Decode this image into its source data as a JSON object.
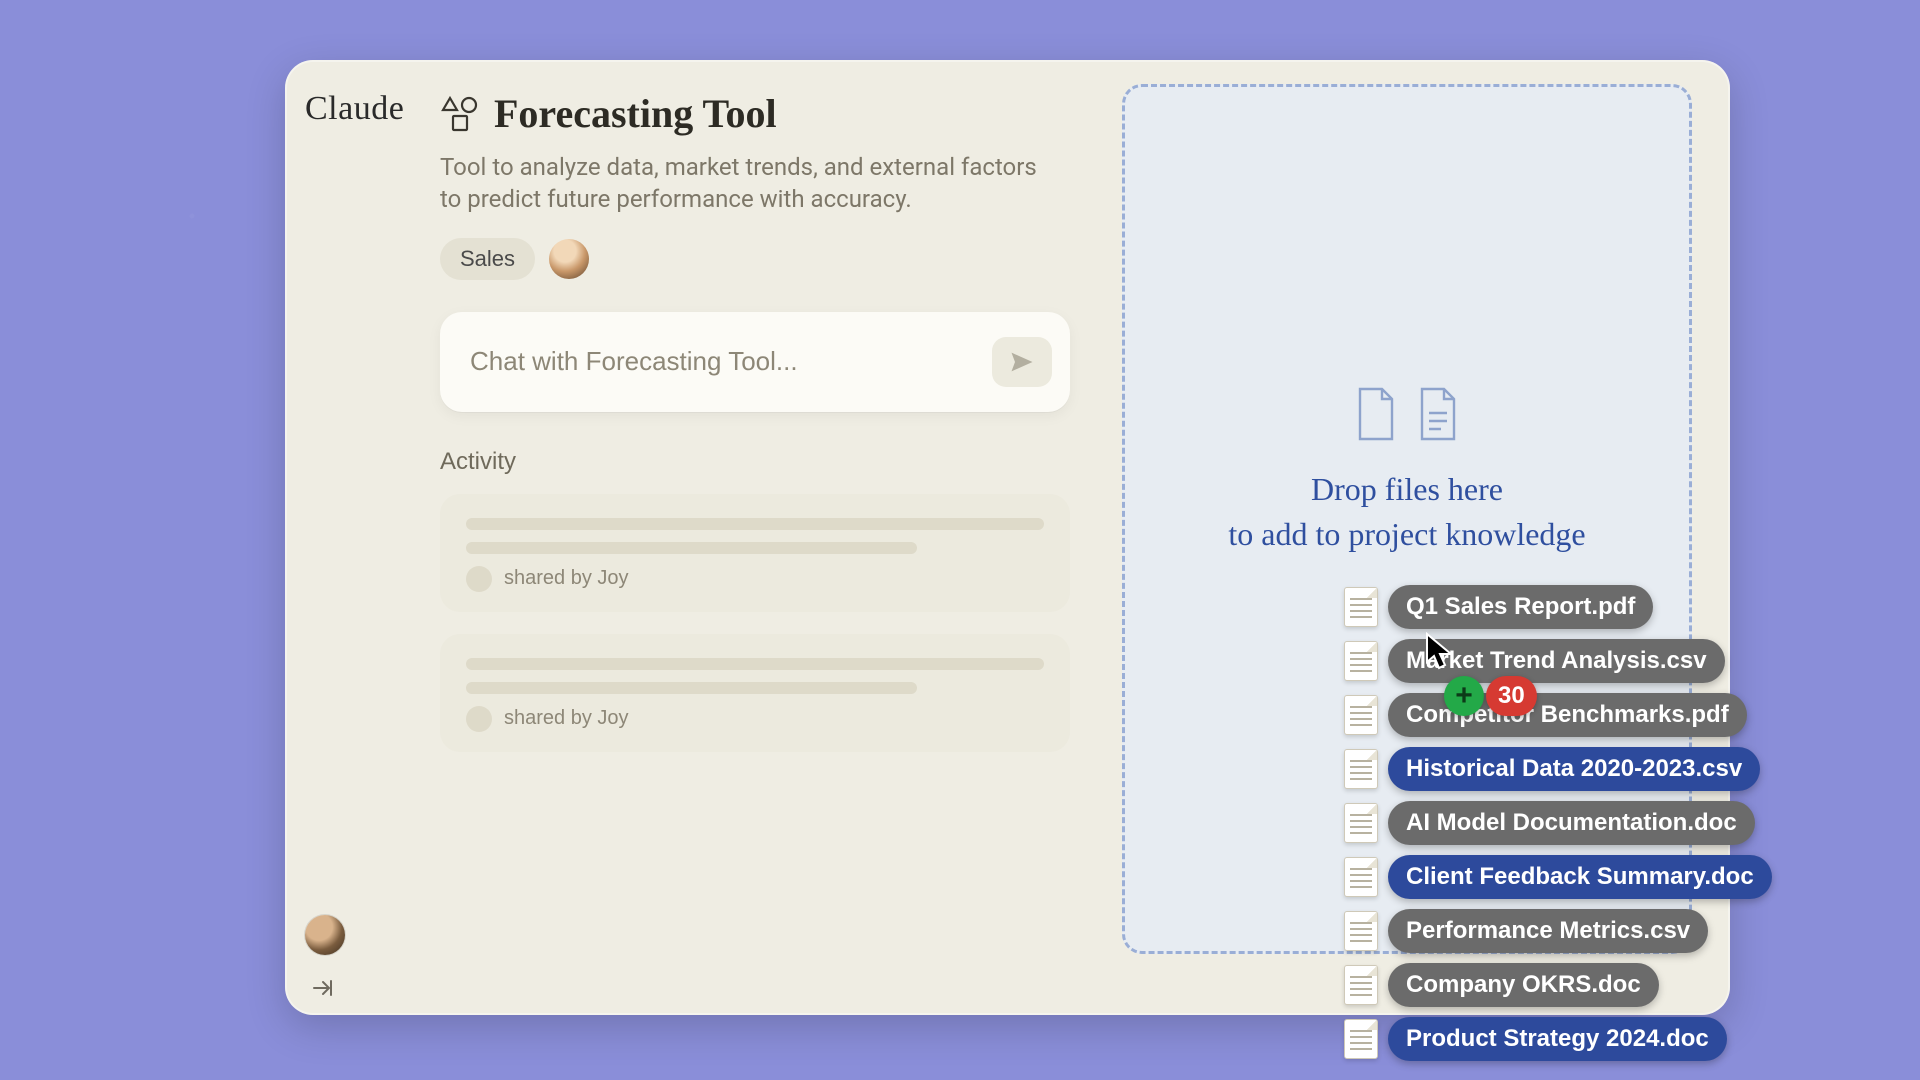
{
  "brand": "Claude",
  "page": {
    "title": "Forecasting Tool",
    "description": "Tool to analyze data, market trends, and external factors to predict future performance with accuracy.",
    "tag": "Sales"
  },
  "chat": {
    "placeholder": "Chat with Forecasting Tool..."
  },
  "activity": {
    "heading": "Activity",
    "items": [
      {
        "shared_by": "shared by Joy"
      },
      {
        "shared_by": "shared by Joy"
      }
    ]
  },
  "dropzone": {
    "line1": "Drop files here",
    "line2": "to add to project knowledge"
  },
  "drag": {
    "count": "30",
    "plus": "+",
    "files": [
      {
        "name": "Q1 Sales Report.pdf",
        "style": "gray"
      },
      {
        "name": "Market Trend Analysis.csv",
        "style": "gray"
      },
      {
        "name": "Competitor Benchmarks.pdf",
        "style": "gray"
      },
      {
        "name": "Historical Data 2020-2023.csv",
        "style": "blue"
      },
      {
        "name": "AI Model Documentation.doc",
        "style": "gray"
      },
      {
        "name": "Client Feedback Summary.doc",
        "style": "blue"
      },
      {
        "name": "Performance Metrics.csv",
        "style": "gray"
      },
      {
        "name": "Company OKRS.doc",
        "style": "gray"
      },
      {
        "name": "Product Strategy 2024.doc",
        "style": "blue"
      }
    ]
  }
}
